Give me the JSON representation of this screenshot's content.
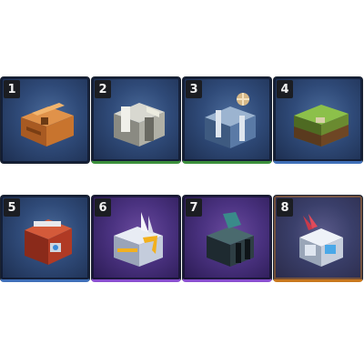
{
  "inventory": {
    "slots": [
      {
        "number": "1",
        "icon": "bronze-chest-icon",
        "rarity": "common"
      },
      {
        "number": "2",
        "icon": "silver-chest-icon",
        "rarity": "green"
      },
      {
        "number": "3",
        "icon": "steel-chest-icon",
        "rarity": "green"
      },
      {
        "number": "4",
        "icon": "mossy-chest-icon",
        "rarity": "blue"
      },
      {
        "number": "5",
        "icon": "red-armor-chest-icon",
        "rarity": "blue"
      },
      {
        "number": "6",
        "icon": "winged-gold-chest-icon",
        "rarity": "purple"
      },
      {
        "number": "7",
        "icon": "dark-chest-icon",
        "rarity": "purple"
      },
      {
        "number": "8",
        "icon": "crystal-chest-icon",
        "rarity": "orange"
      }
    ]
  },
  "colors": {
    "slot_bg": "#2f4a78",
    "green_rarity": "#3b8f3b",
    "blue_rarity": "#3f6fb8",
    "purple_rarity": "#8a4fd0",
    "orange_rarity": "#c8781e"
  }
}
